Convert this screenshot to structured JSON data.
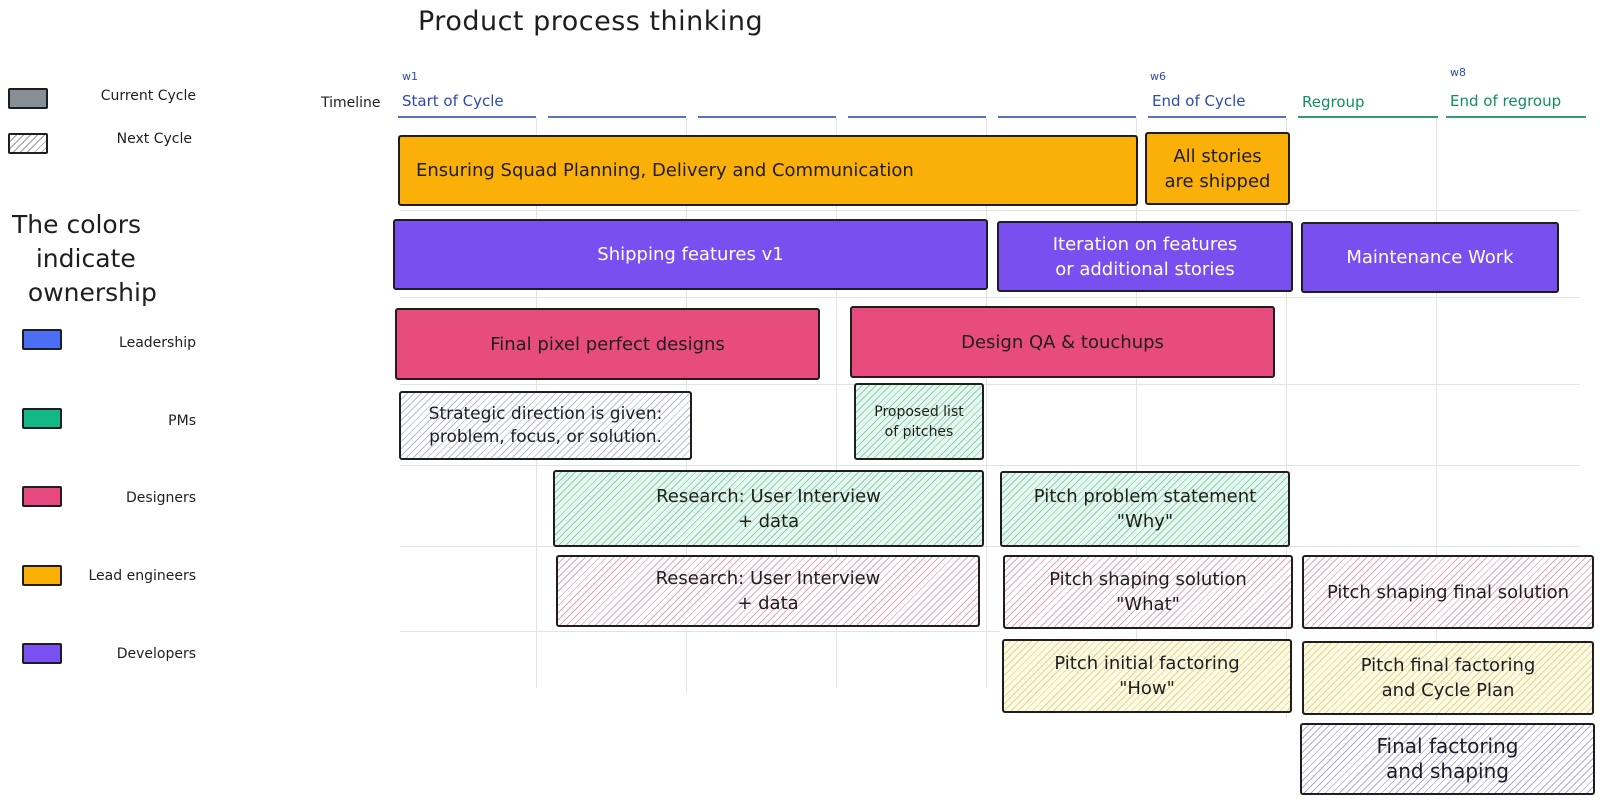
{
  "title": "Product process thinking",
  "cycle_legend": [
    {
      "label": "Current Cycle",
      "style": "solid",
      "color": "#868e96"
    },
    {
      "label": "Next Cycle",
      "style": "hatched",
      "color": "#9a9a9a"
    }
  ],
  "ownership": {
    "heading": "The colors\n   indicate\n  ownership",
    "items": [
      {
        "label": "Leadership",
        "color": "#4c6ef5"
      },
      {
        "label": "PMs",
        "color": "#12b886"
      },
      {
        "label": "Designers",
        "color": "#e64980"
      },
      {
        "label": "Lead engineers",
        "color": "#fab005"
      },
      {
        "label": "Developers",
        "color": "#7950f2"
      }
    ]
  },
  "timeline": {
    "label": "Timeline",
    "weeks": [
      "w1",
      "w6",
      "w8"
    ],
    "milestones": [
      {
        "label": "Start of Cycle",
        "color": "#2b4ab3"
      },
      {
        "label": "End of Cycle",
        "color": "#2b4ab3"
      },
      {
        "label": "Regroup",
        "color": "#0f8f5f"
      },
      {
        "label": "End of regroup",
        "color": "#0f8f5f"
      }
    ]
  },
  "tasks": [
    {
      "label": "Ensuring Squad Planning, Delivery and Communication",
      "owner": "Lead engineers",
      "cycle": "current"
    },
    {
      "label": "All stories\nare shipped",
      "owner": "Lead engineers",
      "cycle": "current"
    },
    {
      "label": "Shipping features v1",
      "owner": "Developers",
      "cycle": "current"
    },
    {
      "label": "Iteration on features\nor additional stories",
      "owner": "Developers",
      "cycle": "current"
    },
    {
      "label": "Maintenance Work",
      "owner": "Developers",
      "cycle": "current"
    },
    {
      "label": "Final pixel perfect designs",
      "owner": "Designers",
      "cycle": "current"
    },
    {
      "label": "Design QA & touchups",
      "owner": "Designers",
      "cycle": "current"
    },
    {
      "label": "Strategic direction is given:\nproblem, focus, or solution.",
      "owner": "Leadership",
      "cycle": "next"
    },
    {
      "label": "Proposed list\nof pitches",
      "owner": "PMs",
      "cycle": "next"
    },
    {
      "label": "Research: User Interview\n+ data",
      "owner": "PMs",
      "cycle": "next"
    },
    {
      "label": "Pitch problem statement\n\"Why\"",
      "owner": "PMs",
      "cycle": "next"
    },
    {
      "label": "Research: User Interview\n+ data",
      "owner": "Designers",
      "cycle": "next"
    },
    {
      "label": "Pitch shaping solution\n\"What\"",
      "owner": "Designers",
      "cycle": "next"
    },
    {
      "label": "Pitch shaping final solution",
      "owner": "Designers",
      "cycle": "next"
    },
    {
      "label": "Pitch initial factoring\n\"How\"",
      "owner": "Lead engineers",
      "cycle": "next"
    },
    {
      "label": "Pitch final factoring\nand Cycle Plan",
      "owner": "Lead engineers",
      "cycle": "next"
    },
    {
      "label": "Final factoring\nand shaping",
      "owner": "Developers",
      "cycle": "next"
    }
  ]
}
